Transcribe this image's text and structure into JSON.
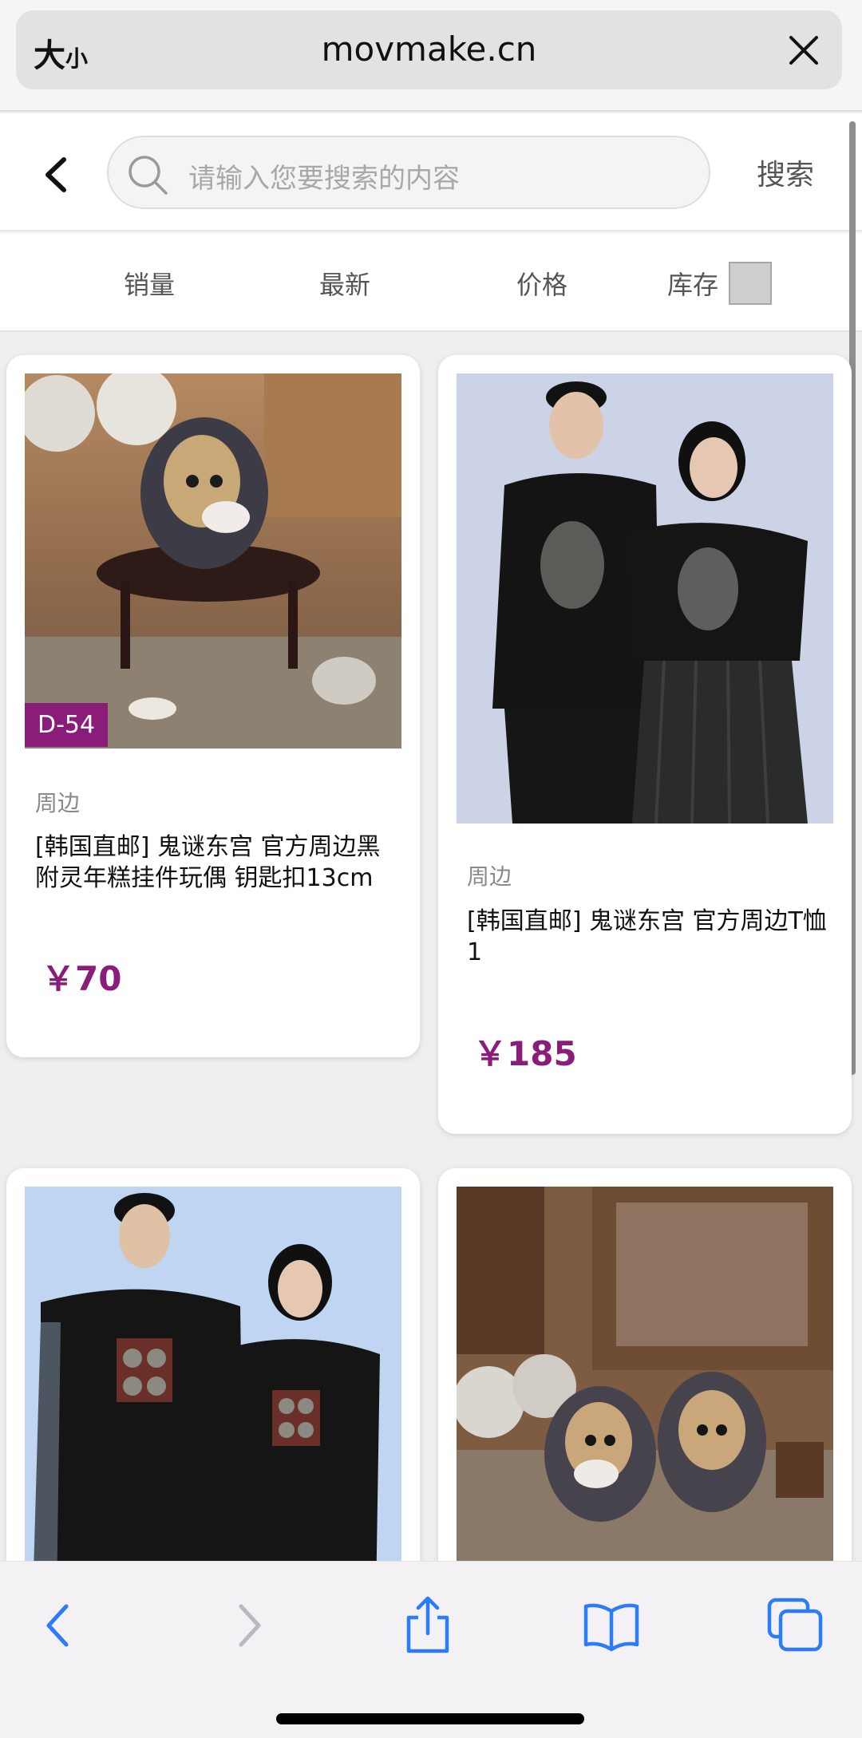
{
  "browser": {
    "text_size_label": "大",
    "text_size_small": "小",
    "url": "movmake.cn"
  },
  "search": {
    "placeholder": "请输入您要搜索的内容",
    "button": "搜索"
  },
  "sort": {
    "sales": "销量",
    "newest": "最新",
    "price": "价格",
    "stock": "库存"
  },
  "products": [
    {
      "badge": "D-54",
      "category": "周边",
      "title": "[韩国直邮] 鬼谜东宫 官方周边黑附灵年糕挂件玩偶 钥匙扣13cm",
      "price": "￥70"
    },
    {
      "category": "周边",
      "title": "[韩国直邮] 鬼谜东宫 官方周边T恤1",
      "price": "￥185"
    },
    {
      "category": "",
      "title": "",
      "price": ""
    },
    {
      "category": "",
      "title": "",
      "price": ""
    }
  ],
  "colors": {
    "accent": "#8b1d7a",
    "ios_blue": "#2b7cf6"
  },
  "icons": {
    "close": "close-icon",
    "back": "chevron-left-icon",
    "search": "search-icon",
    "share": "share-icon",
    "bookmarks": "book-icon",
    "tabs": "tabs-icon"
  }
}
